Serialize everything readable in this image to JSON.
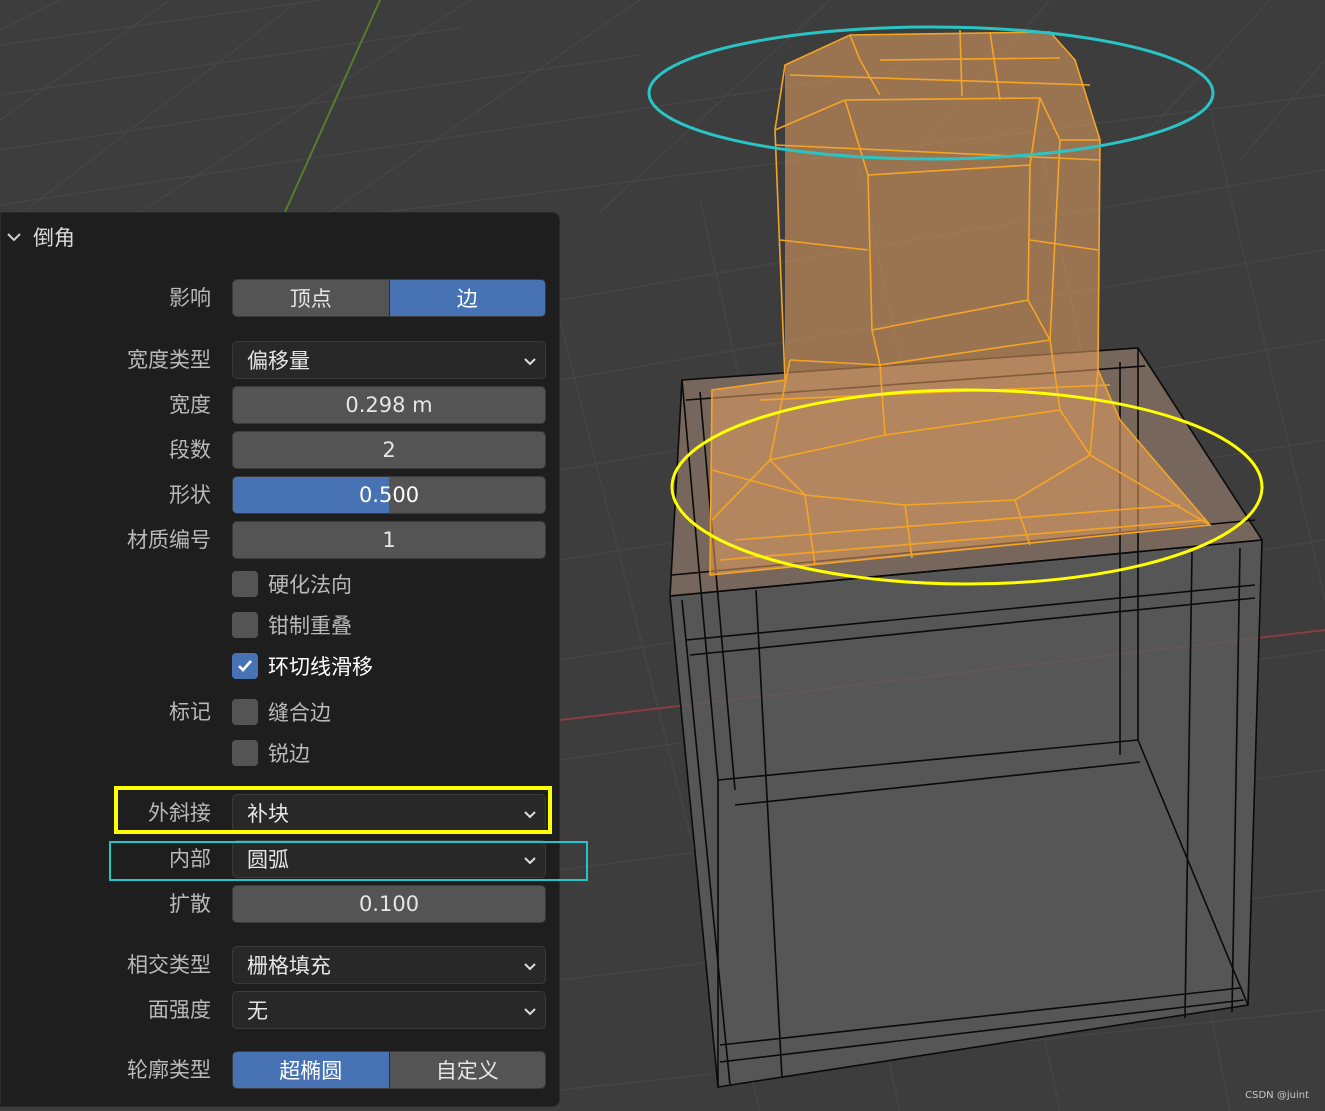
{
  "panel": {
    "title": "倒角",
    "affect": {
      "label": "影响",
      "options": [
        "顶点",
        "边"
      ],
      "selected": "边"
    },
    "width_type": {
      "label": "宽度类型",
      "value": "偏移量"
    },
    "width": {
      "label": "宽度",
      "value": "0.298 m"
    },
    "segments": {
      "label": "段数",
      "value": "2"
    },
    "shape": {
      "label": "形状",
      "value": "0.500",
      "fraction": 0.5
    },
    "material_index": {
      "label": "材质编号",
      "value": "1"
    },
    "checkboxes": [
      {
        "label": "硬化法向",
        "checked": false
      },
      {
        "label": "钳制重叠",
        "checked": false
      },
      {
        "label": "环切线滑移",
        "checked": true
      }
    ],
    "mark": {
      "label": "标记",
      "items": [
        {
          "label": "缝合边",
          "checked": false
        },
        {
          "label": "锐边",
          "checked": false
        }
      ]
    },
    "miter_outer": {
      "label": "外斜接",
      "value": "补块"
    },
    "miter_inner": {
      "label": "内部",
      "value": "圆弧"
    },
    "spread": {
      "label": "扩散",
      "value": "0.100"
    },
    "intersection_type": {
      "label": "相交类型",
      "value": "栅格填充"
    },
    "face_strength": {
      "label": "面强度",
      "value": "无"
    },
    "profile_type": {
      "label": "轮廓类型",
      "options": [
        "超椭圆",
        "自定义"
      ],
      "selected": "超椭圆"
    }
  },
  "highlight_colors": {
    "outer_miter": "#ffff00",
    "inner_miter": "#22c6c6"
  },
  "watermark": "CSDN @juint"
}
